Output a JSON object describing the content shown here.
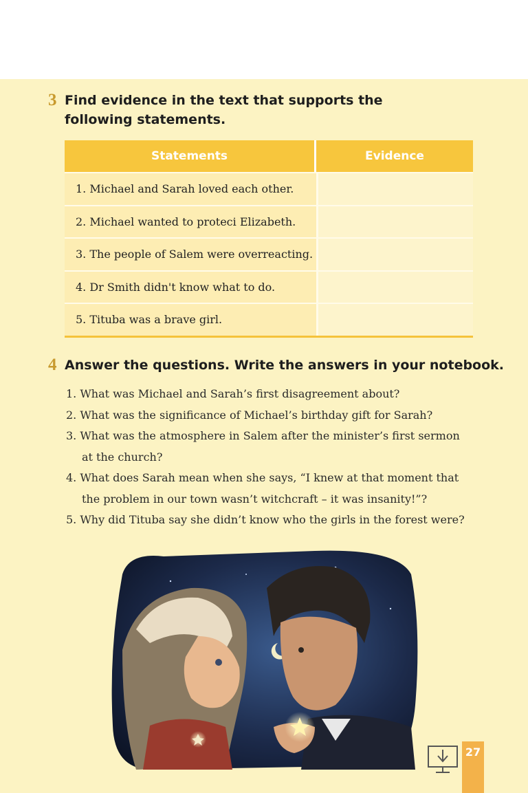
{
  "exercise3": {
    "number": "3",
    "title": "Find evidence in the text that supports the following statements."
  },
  "table": {
    "headers": [
      "Statements",
      "Evidence"
    ],
    "rows": [
      {
        "statement": "1.  Michael and Sarah loved each other.",
        "evidence": ""
      },
      {
        "statement": "2.  Michael wanted to proteci Elizabeth.",
        "evidence": ""
      },
      {
        "statement": "3.  The people of Salem were overreacting.",
        "evidence": ""
      },
      {
        "statement": "4.  Dr Smith didn't know what to do.",
        "evidence": ""
      },
      {
        "statement": "5.  Tituba was a brave girl.",
        "evidence": ""
      }
    ]
  },
  "exercise4": {
    "number": "4",
    "title": "Answer the questions. Write the answers in your notebook.",
    "questions": [
      {
        "line1": "1.  What was Michael and Sarah’s first disagreement about?"
      },
      {
        "line1": "2.  What was the significance of Michael’s birthday gift for Sarah?"
      },
      {
        "line1": "3.  What was the atmosphere in Salem after the minister’s first sermon",
        "line2": "at the church?"
      },
      {
        "line1": "4.  What does Sarah mean when she says, “I knew at that moment that",
        "line2": "the problem in our town wasn’t witchcraft – it was insanity!”?"
      },
      {
        "line1": "5.  Why did Tituba say she didn’t know who the girls in the forest were?"
      }
    ]
  },
  "footer": {
    "page_number": "27",
    "icon": "download-icon"
  },
  "colors": {
    "page_bg": "#fcf3c3",
    "table_header": "#f7c63d",
    "exercise_number": "#c89a2e",
    "page_tab": "#f3b24a"
  }
}
